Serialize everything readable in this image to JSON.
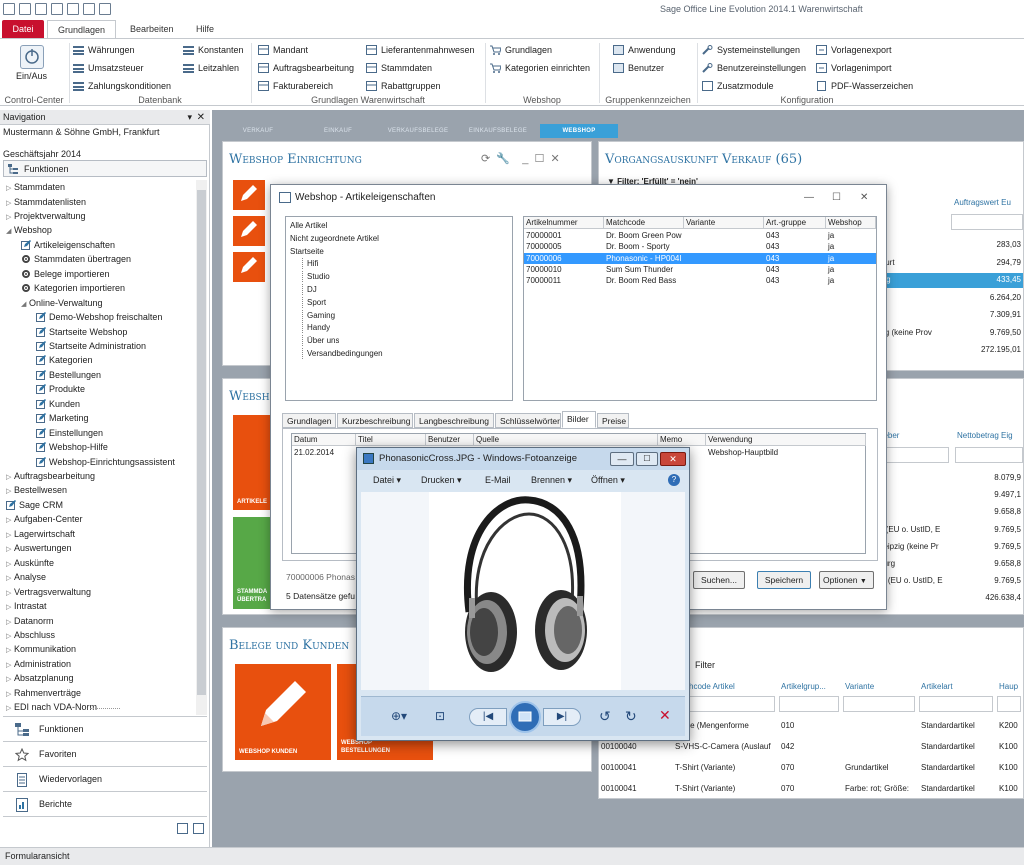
{
  "app": {
    "title": "Sage Office Line Evolution 2014.1 Warenwirtschaft"
  },
  "ribbon": {
    "tabs": [
      "Datei",
      "Grundlagen",
      "Bearbeiten",
      "Hilfe"
    ],
    "control_center": {
      "button": "Ein/Aus",
      "group": "Control-Center"
    },
    "datenbank": {
      "items": [
        "Währungen",
        "Umsatzsteuer",
        "Zahlungskonditionen",
        "Konstanten",
        "Leitzahlen"
      ],
      "group": "Datenbank"
    },
    "grundlagen_ww": {
      "items": [
        "Mandant",
        "Auftragsbearbeitung",
        "Fakturabereich",
        "Lieferantenmahnwesen",
        "Stammdaten",
        "Rabattgruppen"
      ],
      "group": "Grundlagen Warenwirtschaft"
    },
    "webshop": {
      "items": [
        "Grundlagen",
        "Kategorien einrichten"
      ],
      "group": "Webshop"
    },
    "gruppen": {
      "items": [
        "Anwendung",
        "Benutzer"
      ],
      "group": "Gruppenkennzeichen"
    },
    "konfig": {
      "items": [
        "Systemeinstellungen",
        "Benutzereinstellungen",
        "Zusatzmodule",
        "Vorlagenexport",
        "Vorlagenimport",
        "PDF-Wasserzeichen"
      ],
      "group": "Konfiguration"
    }
  },
  "nav": {
    "header": "Navigation",
    "company": "Mustermann & Söhne GmbH, Frankfurt",
    "fiscal": "Geschäftsjahr 2014",
    "funktionen_header": "Funktionen",
    "tree": [
      {
        "label": "Stammdaten",
        "level": 0,
        "exp": "▷"
      },
      {
        "label": "Stammdatenlisten",
        "level": 0,
        "exp": "▷"
      },
      {
        "label": "Projektverwaltung",
        "level": 0,
        "exp": "▷"
      },
      {
        "label": "Webshop",
        "level": 0,
        "exp": "◢"
      },
      {
        "label": "Artikeleigenschaften",
        "level": 1,
        "icon": "pencil"
      },
      {
        "label": "Stammdaten übertragen",
        "level": 1,
        "icon": "gear"
      },
      {
        "label": "Belege importieren",
        "level": 1,
        "icon": "gear"
      },
      {
        "label": "Kategorien importieren",
        "level": 1,
        "icon": "gear"
      },
      {
        "label": "Online-Verwaltung",
        "level": 1,
        "exp": "◢"
      },
      {
        "label": "Demo-Webshop freischalten",
        "level": 2,
        "icon": "pencil"
      },
      {
        "label": "Startseite Webshop",
        "level": 2,
        "icon": "pencil"
      },
      {
        "label": "Startseite Administration",
        "level": 2,
        "icon": "pencil"
      },
      {
        "label": "Kategorien",
        "level": 2,
        "icon": "pencil"
      },
      {
        "label": "Bestellungen",
        "level": 2,
        "icon": "pencil"
      },
      {
        "label": "Produkte",
        "level": 2,
        "icon": "pencil"
      },
      {
        "label": "Kunden",
        "level": 2,
        "icon": "pencil"
      },
      {
        "label": "Marketing",
        "level": 2,
        "icon": "pencil"
      },
      {
        "label": "Einstellungen",
        "level": 2,
        "icon": "pencil"
      },
      {
        "label": "Webshop-Hilfe",
        "level": 2,
        "icon": "pencil"
      },
      {
        "label": "Webshop-Einrichtungsassistent",
        "level": 2,
        "icon": "pencil"
      },
      {
        "label": "Auftragsbearbeitung",
        "level": 0,
        "exp": "▷"
      },
      {
        "label": "Bestellwesen",
        "level": 0,
        "exp": "▷"
      },
      {
        "label": "Sage CRM",
        "level": 0,
        "icon": "pencil"
      },
      {
        "label": "Aufgaben-Center",
        "level": 0,
        "exp": "▷"
      },
      {
        "label": "Lagerwirtschaft",
        "level": 0,
        "exp": "▷"
      },
      {
        "label": "Auswertungen",
        "level": 0,
        "exp": "▷"
      },
      {
        "label": "Auskünfte",
        "level": 0,
        "exp": "▷"
      },
      {
        "label": "Analyse",
        "level": 0,
        "exp": "▷"
      },
      {
        "label": "Vertragsverwaltung",
        "level": 0,
        "exp": "▷"
      },
      {
        "label": "Intrastat",
        "level": 0,
        "exp": "▷"
      },
      {
        "label": "Datanorm",
        "level": 0,
        "exp": "▷"
      },
      {
        "label": "Abschluss",
        "level": 0,
        "exp": "▷"
      },
      {
        "label": "Kommunikation",
        "level": 0,
        "exp": "▷"
      },
      {
        "label": "Administration",
        "level": 0,
        "exp": "▷"
      },
      {
        "label": "Absatzplanung",
        "level": 0,
        "exp": "▷"
      },
      {
        "label": "Rahmenverträge",
        "level": 0,
        "exp": "▷"
      },
      {
        "label": "EDI nach VDA-Norm",
        "level": 0,
        "exp": "▷"
      }
    ],
    "buttons": [
      "Funktionen",
      "Favoriten",
      "Wiedervorlagen",
      "Berichte"
    ]
  },
  "main": {
    "tabs": [
      "VERKAUF",
      "EINKAUF",
      "VERKAUFSBELEGE",
      "EINKAUFSBELEGE",
      "WEBSHOP"
    ],
    "panel_left_title": "Webshop Einrichtung",
    "panel_left2_title": "Websh",
    "panel_left3_title": "Belege und Kunden",
    "tiles": [
      "ARTIKELE",
      "STAMMDA ÜBERTRA",
      "WEBSHOP KUNDEN",
      "WEBSHOP BESTELLUNGEN"
    ],
    "panel_right_title": "Vorgangsauskunft Verkauf (65)",
    "filter": "Filter: 'Erfüllt' = 'nein'",
    "right_col_header": "Auftragswert Eu",
    "right_values": [
      "283,03",
      "294,79",
      "433,45",
      "6.264,20",
      "7.309,91",
      "9.769,50",
      "272.195,01"
    ],
    "right_texts": [
      "",
      "kfurt",
      "urg",
      "",
      "",
      "zig (keine Prov",
      ""
    ],
    "panel_right2_cols": [
      "geber",
      "Nettobetrag Eig"
    ],
    "right2_values": [
      "8.079,9",
      "9.497,1",
      "9.658,8",
      "9.769,5",
      "9.769,5",
      "9.658,8",
      "9.769,5",
      "426.638,4"
    ],
    "right2_texts": [
      "e",
      "e",
      "",
      "a (EU o. UstID, E",
      "Leipzig (keine Pr",
      "burg",
      "o. (EU o. UstID, E",
      ""
    ],
    "panel_right3_title": "ift",
    "panel_right3_filter": "Filter",
    "bottom_cols": [
      "hcode Artikel",
      "Artikelgrup...",
      "Variante",
      "Artikelart",
      "Haup"
    ],
    "bottom_rows": [
      [
        "",
        "platte (Mengenforme",
        "010",
        "",
        "Standardartikel",
        "K200"
      ],
      [
        "00100040",
        "S-VHS-C-Camera (Auslauf",
        "042",
        "",
        "Standardartikel",
        "K100"
      ],
      [
        "00100041",
        "T-Shirt (Variante)",
        "070",
        "Grundartikel",
        "Standardartikel",
        "K100"
      ],
      [
        "00100041",
        "T-Shirt (Variante)",
        "070",
        "Farbe: rot; Größe:",
        "Standardartikel",
        "K100"
      ]
    ]
  },
  "dialog": {
    "title": "Webshop - Artikeleigenschaften",
    "tree": [
      "Alle Artikel",
      "Nicht zugeordnete Artikel",
      "Startseite",
      "Hifi",
      "Studio",
      "DJ",
      "Sport",
      "Gaming",
      "Handy",
      "Über uns",
      "Versandbedingungen"
    ],
    "cols": [
      "Artikelnummer",
      "Matchcode",
      "Variante",
      "Art.-gruppe",
      "Webshop"
    ],
    "rows": [
      [
        "70000001",
        "Dr. Boom Green Pow",
        "",
        "043",
        "ja"
      ],
      [
        "70000005",
        "Dr. Boom - Sporty",
        "",
        "043",
        "ja"
      ],
      [
        "70000006",
        "Phonasonic - HP004I",
        "",
        "043",
        "ja"
      ],
      [
        "70000010",
        "Sum Sum Thunder",
        "",
        "043",
        "ja"
      ],
      [
        "70000011",
        "Dr. Boom Red Bass",
        "",
        "043",
        "ja"
      ]
    ],
    "tabs": [
      "Grundlagen",
      "Kurzbeschreibung",
      "Langbeschreibung",
      "Schlüsselwörter",
      "Bilder",
      "Preise"
    ],
    "img_cols": [
      "Datum",
      "Titel",
      "Benutzer",
      "Quelle",
      "Memo",
      "Verwendung"
    ],
    "img_row": [
      "21.02.2014",
      "",
      "",
      "",
      "",
      "Webshop-Hauptbild"
    ],
    "status1": "70000006 Phonas",
    "status2": "5 Datensätze gefu",
    "buttons": [
      "Suchen...",
      "Speichern",
      "Optionen"
    ]
  },
  "viewer": {
    "title": "PhonasonicCross.JPG - Windows-Fotoanzeige",
    "menu": [
      "Datei",
      "Drucken",
      "E-Mail",
      "Brennen",
      "Öffnen"
    ]
  },
  "status": {
    "left": "Formularansicht"
  }
}
